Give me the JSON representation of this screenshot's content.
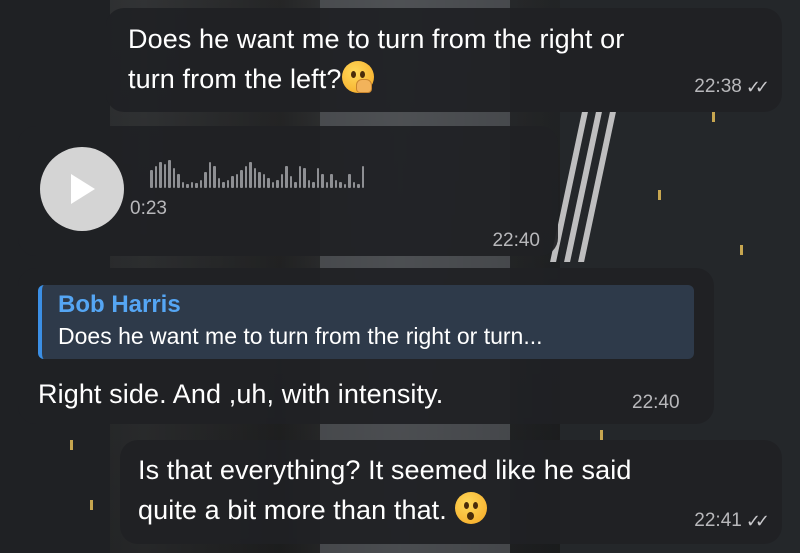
{
  "messages": [
    {
      "id": "msg1",
      "text_line1": "Does he want me to turn from the right or",
      "text_line2": "turn from the left?",
      "emoji": "thinking-face",
      "time": "22:38",
      "status": "read"
    },
    {
      "id": "msg2",
      "type": "voice",
      "duration": "0:23",
      "time": "22:40"
    },
    {
      "id": "msg3",
      "reply_author": "Bob Harris",
      "reply_preview": "Does he want me to turn from the right or turn...",
      "text": "Right side. And ,uh, with intensity.",
      "time": "22:40"
    },
    {
      "id": "msg4",
      "text_line1": "Is that everything? It seemed like he said",
      "text_line2": "quite a bit more than that.",
      "emoji": "hushed-face",
      "time": "22:41",
      "status": "read"
    }
  ],
  "colors": {
    "bubble": "#202124",
    "accent": "#55a6f4",
    "reply_bar": "#3b8fe5",
    "meta_text": "#b8b8bb"
  }
}
